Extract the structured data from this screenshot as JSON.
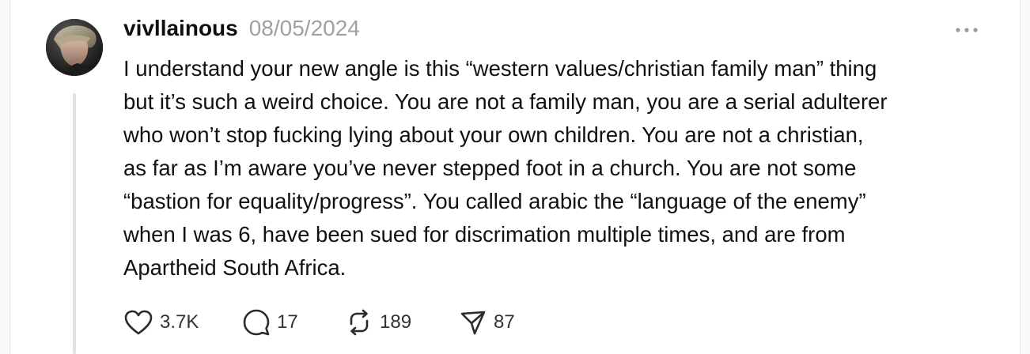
{
  "post": {
    "username": "vivllainous",
    "date": "08/05/2024",
    "lines": [
      "I understand your new angle is this “western values/christian family man” thing",
      "but it’s such a weird choice. You are not a family man, you are a serial adulterer",
      "who won’t stop fucking lying about your own children. You are not a christian,",
      "as far as I’m aware you’ve never stepped foot in a church. You are not some",
      "“bastion for equality/progress”. You called arabic the “language of the enemy”",
      "when I was 6, have been sued for discrimation multiple times, and are from",
      "Apartheid South Africa."
    ],
    "more_icon": "more-horizontal-icon"
  },
  "actions": {
    "likes": "3.7K",
    "replies": "17",
    "reposts": "189",
    "shares": "87",
    "icons": [
      "heart-icon",
      "reply-bubble-icon",
      "repost-icon",
      "share-icon"
    ]
  },
  "colors": {
    "text": "#0f0f0f",
    "muted": "#a0a0a0",
    "thread_line": "#e2e2e2"
  }
}
